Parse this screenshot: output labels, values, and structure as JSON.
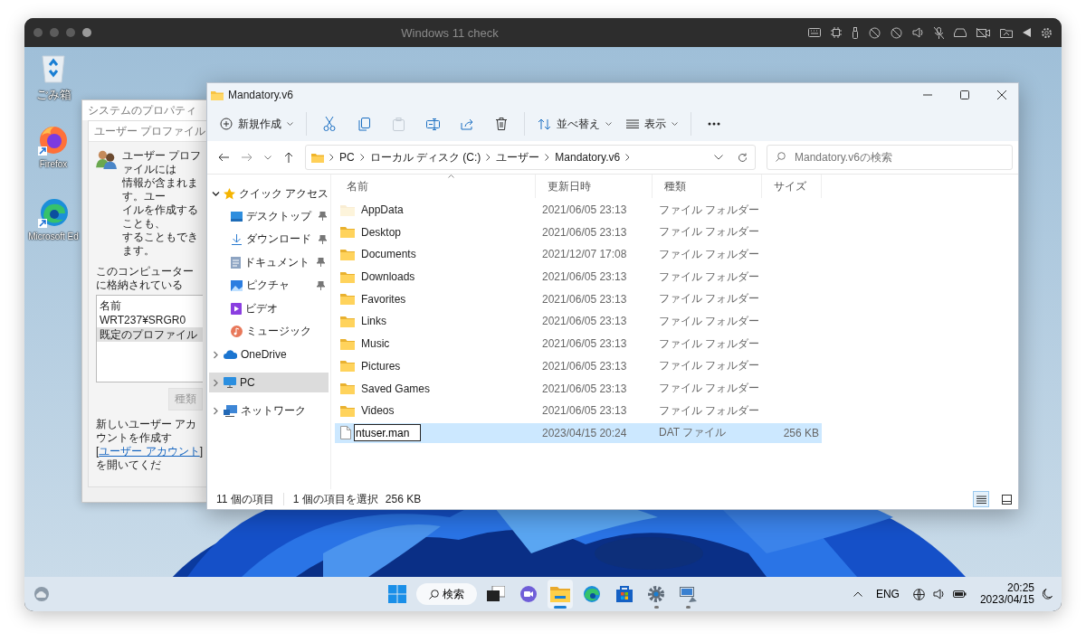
{
  "host_window": {
    "title": "Windows 11 check"
  },
  "desktop_icons": [
    {
      "label": "ごみ箱",
      "kind": "recycle"
    },
    {
      "label": "Firefox",
      "kind": "firefox"
    },
    {
      "label": "Microsoft Ed",
      "kind": "edge"
    }
  ],
  "system_properties": {
    "title": "システムのプロパティ",
    "panel_title": "ユーザー プロファイル",
    "description_lines": [
      "ユーザー プロファイルには",
      "情報が含まれます。ユー",
      "イルを作成することも、",
      "することもできます。"
    ],
    "stored_label": "このコンピューターに格納されている",
    "list_header": "名前",
    "profiles": [
      {
        "name": "WRT237¥SRGR0",
        "selected": false
      },
      {
        "name": "既定のプロファイル",
        "selected": true
      }
    ],
    "button": "種類",
    "footer_line": "新しいユーザー アカウントを作成す",
    "footer_before": "[",
    "footer_link": "ユーザー アカウント",
    "footer_after": "] を開いてくだ"
  },
  "explorer": {
    "title": "Mandatory.v6",
    "toolbar": [
      {
        "kind": "new",
        "label": "新規作成",
        "disabled": false
      },
      {
        "kind": "cut",
        "disabled": false
      },
      {
        "kind": "copy",
        "disabled": false
      },
      {
        "kind": "paste",
        "disabled": true
      },
      {
        "kind": "rename",
        "disabled": false
      },
      {
        "kind": "share",
        "disabled": false
      },
      {
        "kind": "delete",
        "disabled": false
      },
      {
        "kind": "sort",
        "label": "並べ替え",
        "disabled": false
      },
      {
        "kind": "view",
        "label": "表示",
        "disabled": false
      },
      {
        "kind": "more",
        "disabled": false
      }
    ],
    "breadcrumb": [
      "PC",
      "ローカル ディスク (C:)",
      "ユーザー",
      "Mandatory.v6"
    ],
    "search": {
      "placeholder": "Mandatory.v6の検索"
    },
    "nav": [
      {
        "label": "クイック アクセス",
        "kind": "star",
        "expanded": true,
        "selected": false,
        "children": [
          {
            "label": "デスクトップ",
            "kind": "desktop",
            "pinned": true,
            "selected": false
          },
          {
            "label": "ダウンロード",
            "kind": "download",
            "pinned": true,
            "selected": false
          },
          {
            "label": "ドキュメント",
            "kind": "document",
            "pinned": true,
            "selected": false
          },
          {
            "label": "ピクチャ",
            "kind": "pictures",
            "pinned": true,
            "selected": false
          },
          {
            "label": "ビデオ",
            "kind": "video",
            "pinned": false,
            "selected": false
          },
          {
            "label": "ミュージック",
            "kind": "music",
            "pinned": false,
            "selected": false
          }
        ]
      },
      {
        "label": "OneDrive",
        "kind": "cloud",
        "expanded": false,
        "selected": false
      },
      {
        "label": "PC",
        "kind": "pc",
        "expanded": false,
        "selected": true
      },
      {
        "label": "ネットワーク",
        "kind": "network",
        "expanded": false,
        "selected": false
      }
    ],
    "columns": [
      "名前",
      "更新日時",
      "種類",
      "サイズ"
    ],
    "files": [
      {
        "name": "AppData",
        "modified": "2021/06/05 23:13",
        "type": "ファイル フォルダー",
        "kind": "folder",
        "hidden": true,
        "selected": false
      },
      {
        "name": "Desktop",
        "modified": "2021/06/05 23:13",
        "type": "ファイル フォルダー",
        "kind": "folder",
        "hidden": false,
        "selected": false
      },
      {
        "name": "Documents",
        "modified": "2021/12/07 17:08",
        "type": "ファイル フォルダー",
        "kind": "folder",
        "hidden": false,
        "selected": false
      },
      {
        "name": "Downloads",
        "modified": "2021/06/05 23:13",
        "type": "ファイル フォルダー",
        "kind": "folder",
        "hidden": false,
        "selected": false
      },
      {
        "name": "Favorites",
        "modified": "2021/06/05 23:13",
        "type": "ファイル フォルダー",
        "kind": "folder",
        "hidden": false,
        "selected": false
      },
      {
        "name": "Links",
        "modified": "2021/06/05 23:13",
        "type": "ファイル フォルダー",
        "kind": "folder",
        "hidden": false,
        "selected": false
      },
      {
        "name": "Music",
        "modified": "2021/06/05 23:13",
        "type": "ファイル フォルダー",
        "kind": "folder",
        "hidden": false,
        "selected": false
      },
      {
        "name": "Pictures",
        "modified": "2021/06/05 23:13",
        "type": "ファイル フォルダー",
        "kind": "folder",
        "hidden": false,
        "selected": false
      },
      {
        "name": "Saved Games",
        "modified": "2021/06/05 23:13",
        "type": "ファイル フォルダー",
        "kind": "folder",
        "hidden": false,
        "selected": false
      },
      {
        "name": "Videos",
        "modified": "2021/06/05 23:13",
        "type": "ファイル フォルダー",
        "kind": "folder",
        "hidden": false,
        "selected": false
      },
      {
        "name": "ntuser.man",
        "modified": "2023/04/15 20:24",
        "type": "DAT ファイル",
        "size": "256 KB",
        "kind": "file",
        "selected": true,
        "renaming": true
      }
    ],
    "status": {
      "count": "11 個の項目",
      "selection": "1 個の項目を選択",
      "selection_size": "256 KB"
    },
    "view_buttons": [
      {
        "kind": "details",
        "selected": true
      },
      {
        "kind": "tiles",
        "selected": false
      }
    ]
  },
  "taskbar": {
    "apps": [
      {
        "kind": "start",
        "running": false,
        "active": false
      },
      {
        "kind": "search",
        "label": "検索"
      },
      {
        "kind": "taskview",
        "running": false,
        "active": false
      },
      {
        "kind": "chat",
        "running": false,
        "active": false
      },
      {
        "kind": "explorer",
        "running": true,
        "active": true
      },
      {
        "kind": "edge",
        "running": false,
        "active": false
      },
      {
        "kind": "store",
        "running": false,
        "active": false
      },
      {
        "kind": "settings",
        "running": true,
        "active": false
      },
      {
        "kind": "remote",
        "running": true,
        "active": false
      }
    ],
    "language": "ENG",
    "time": "20:25",
    "date": "2023/04/15"
  }
}
